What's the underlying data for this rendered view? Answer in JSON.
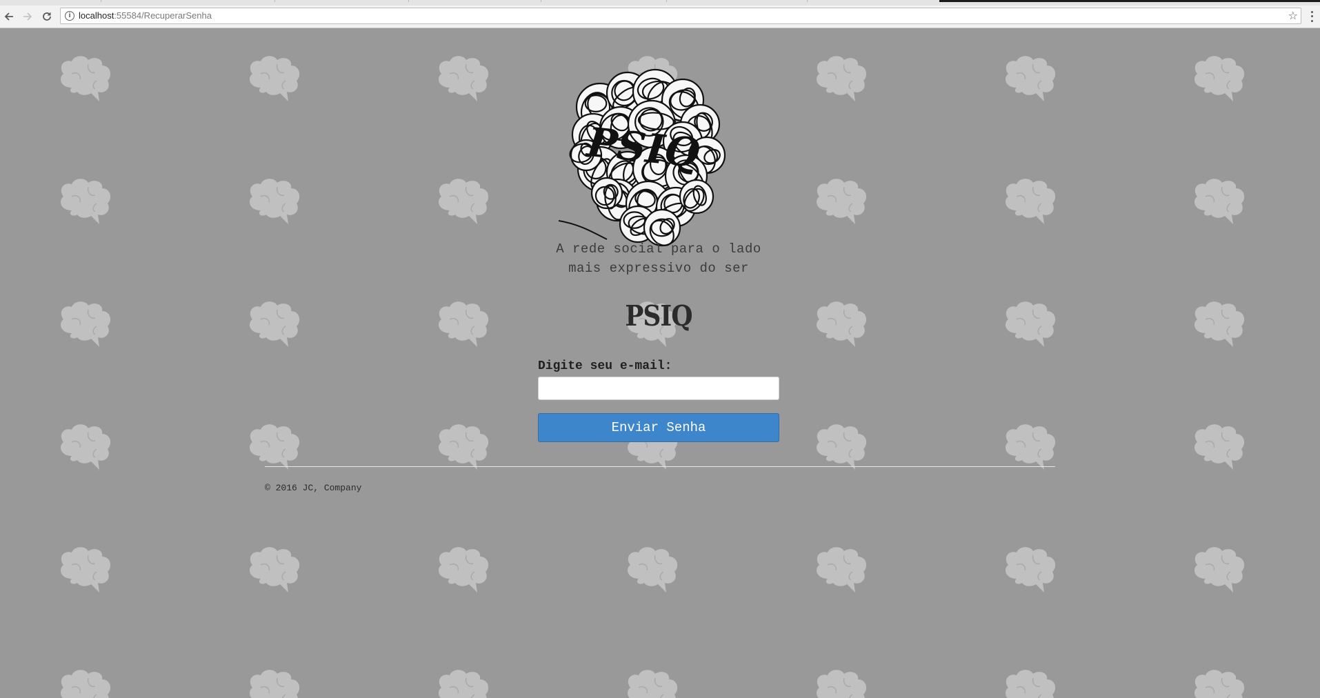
{
  "browser": {
    "url_host": "localhost",
    "url_path": ":55584/RecuperarSenha",
    "back_icon": "back-arrow-icon",
    "forward_icon": "forward-arrow-icon",
    "reload_icon": "reload-icon",
    "info_icon": "info-icon",
    "bookmark_icon": "star-icon",
    "menu_icon": "kebab-menu-icon"
  },
  "page": {
    "background_color": "#999999",
    "pattern_icon": "brain-speech-bubble-icon",
    "logo": {
      "text": "PSIQ",
      "icon": "tangled-scribble-logo"
    },
    "tagline_line1": "A rede social para o lado",
    "tagline_line2": "mais expressivo do ser",
    "brand_title": "PSIQ",
    "form": {
      "email_label": "Digite seu e-mail:",
      "email_value": "",
      "email_placeholder": "",
      "submit_label": "Enviar Senha",
      "submit_color": "#3d86cc"
    },
    "footer": {
      "copyright": "© 2016 JC, Company"
    }
  }
}
